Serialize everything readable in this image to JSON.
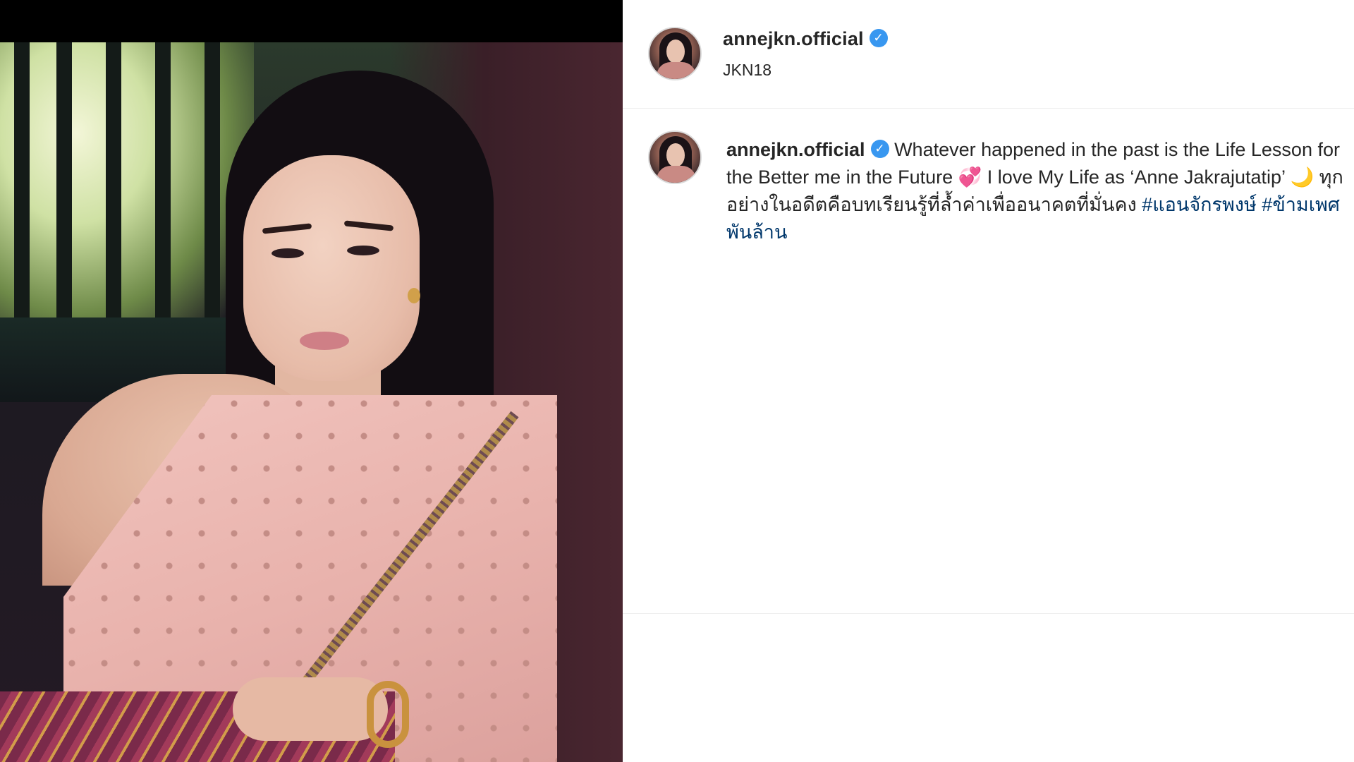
{
  "post": {
    "username": "annejkn.official",
    "verified": true,
    "verified_glyph": "✓",
    "location": "JKN18"
  },
  "caption": {
    "username": "annejkn.official",
    "text_part1": "Whatever happened in the past is the Life Lesson for the Better me in the Future ",
    "emoji1": "💞",
    "emoji1_icon": "two-hearts-icon",
    "text_part2": " I love My Life as ‘Anne Jakrajutatip’ ",
    "emoji2": "🌙",
    "emoji2_icon": "crescent-moon-icon",
    "text_part3": " ทุกอย่างในอดีตคือบทเรียนรู้ที่ล้ำค่าเพื่ออนาคตที่มั่นคง ",
    "hashtags": [
      "#แอนจักรพงษ์",
      "#ข้ามเพศพันล้าน"
    ]
  },
  "colors": {
    "verified_badge": "#3897f0",
    "hashtag": "#00376b",
    "text": "#262626",
    "divider": "#efefef"
  }
}
